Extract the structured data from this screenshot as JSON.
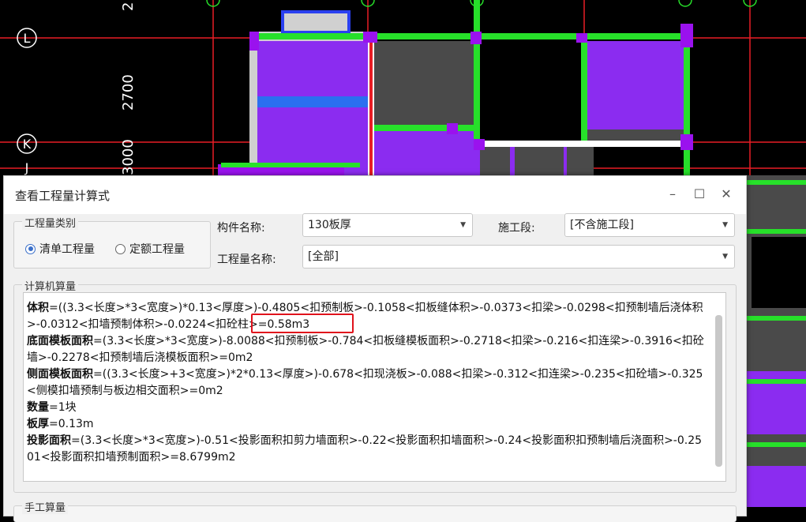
{
  "cad": {
    "dim_top": "2",
    "dim_mid": "2700",
    "dim_bottom": "3000",
    "axis_L": "L",
    "axis_K": "K",
    "axis_J": "J"
  },
  "dialog": {
    "title": "查看工程量计算式",
    "btn_min": "–",
    "btn_max": "☐",
    "btn_close": "✕",
    "category": {
      "legend": "工程量类别",
      "options": [
        "清单工程量",
        "定额工程量"
      ],
      "selected": "清单工程量"
    },
    "component_label": "构件名称:",
    "component_value": "130板厚",
    "stage_label": "施工段:",
    "stage_value": "[不含施工段]",
    "qty_name_label": "工程量名称:",
    "qty_name_value": "[全部]",
    "computer_calc": {
      "legend": "计算机算量",
      "lines": [
        {
          "name": "体积",
          "expr": "=((3.3<长度>*3<宽度>)*0.13<厚度>)-0.4805<扣预制板>-0.1058<扣板缝体积>-0.0373<扣梁>-0.0298<扣预制墙后浇体积>-0.0312<扣墙预制体积>-0.0224<扣砼柱>=0.58m3"
        },
        {
          "name": "底面模板面积",
          "expr": "=(3.3<长度>*3<宽度>)-8.0088<扣预制板>-0.784<扣板缝模板面积>-0.2718<扣梁>-0.216<扣连梁>-0.3916<扣砼墙>-0.2278<扣预制墙后浇模板面积>=0m2"
        },
        {
          "name": "侧面模板面积",
          "expr": "=((3.3<长度>+3<宽度>)*2*0.13<厚度>)-0.678<扣现浇板>-0.088<扣梁>-0.312<扣连梁>-0.235<扣砼墙>-0.325<侧模扣墙预制与板边相交面积>=0m2"
        },
        {
          "name": "数量",
          "expr": "=1块"
        },
        {
          "name": "板厚",
          "expr": "=0.13m"
        },
        {
          "name": "投影面积",
          "expr": "=(3.3<长度>*3<宽度>)-0.51<投影面积扣剪力墙面积>-0.22<投影面积扣墙面积>-0.24<投影面积扣预制墙后浇面积>-0.2501<投影面积扣墙预制面积>=8.6799m2"
        }
      ]
    },
    "manual_legend": "手工算量"
  },
  "colors": {
    "slab": "#8b2cf0",
    "beam": "#27e02a",
    "grid": "#e81d25",
    "column": "#9a12ee",
    "dark": "#4a4a4a"
  }
}
